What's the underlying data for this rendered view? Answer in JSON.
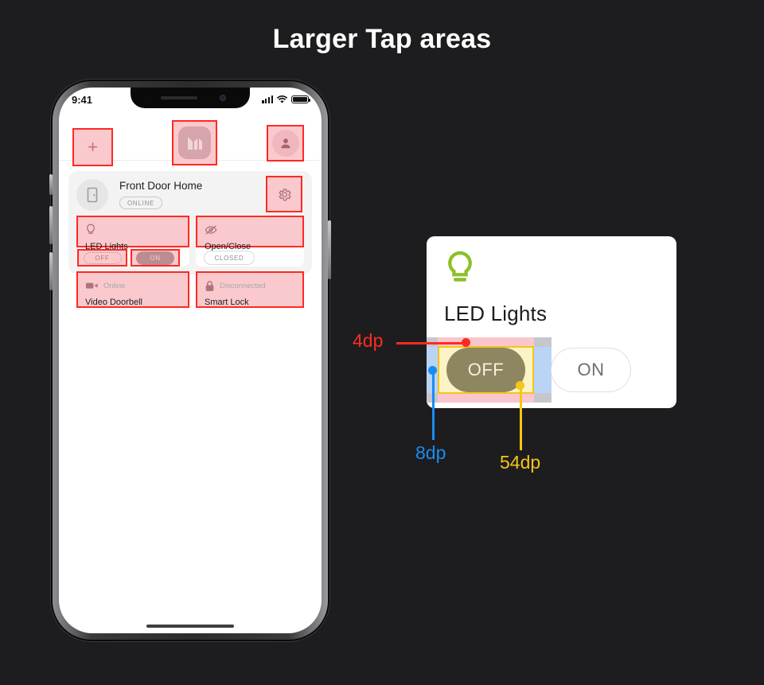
{
  "page": {
    "title": "Larger Tap areas",
    "background_color": "#1d1d1f"
  },
  "phone": {
    "status_bar": {
      "time": "9:41",
      "signal_icon": "cellular-signal-icon",
      "wifi_icon": "wifi-icon",
      "battery_icon": "battery-full-icon"
    },
    "app_bar": {
      "add_label": "+",
      "add_icon": "plus-icon",
      "logo_icon": "app-logo-icon",
      "profile_icon": "person-avatar-icon"
    },
    "home_card": {
      "icon": "door-icon",
      "name": "Front Door Home",
      "status_badge": "ONLINE",
      "settings_icon": "gear-icon",
      "tiles": [
        {
          "icon": "lightbulb-icon",
          "status": "",
          "name": "LED Lights",
          "controls": [
            {
              "label": "OFF",
              "state": "inactive"
            },
            {
              "label": "ON",
              "state": "active"
            }
          ]
        },
        {
          "icon": "eye-slash-icon",
          "status": "",
          "name": "Open/Close",
          "controls": [
            {
              "label": "CLOSED",
              "state": "inactive"
            }
          ]
        },
        {
          "icon": "video-camera-icon",
          "status": "Online",
          "name": "Video Doorbell",
          "controls": []
        },
        {
          "icon": "lock-icon",
          "status": "Disconnected",
          "name": "Smart Lock",
          "controls": []
        }
      ]
    }
  },
  "detail_panel": {
    "icon": "lightbulb-icon",
    "icon_color": "#8cc028",
    "title": "LED Lights",
    "buttons": [
      {
        "label": "OFF",
        "state": "selected"
      },
      {
        "label": "ON",
        "state": "unselected"
      }
    ]
  },
  "annotations": [
    {
      "id": "top-padding",
      "label": "4dp",
      "color": "#ff2a23"
    },
    {
      "id": "side-padding",
      "label": "8dp",
      "color": "#1a8cf0"
    },
    {
      "id": "tap-target-size",
      "label": "54dp",
      "color": "#f5c518"
    }
  ],
  "highlight_colors": {
    "tap_area_fill": "#fac9ce",
    "tap_area_border": "#ff2a23"
  }
}
